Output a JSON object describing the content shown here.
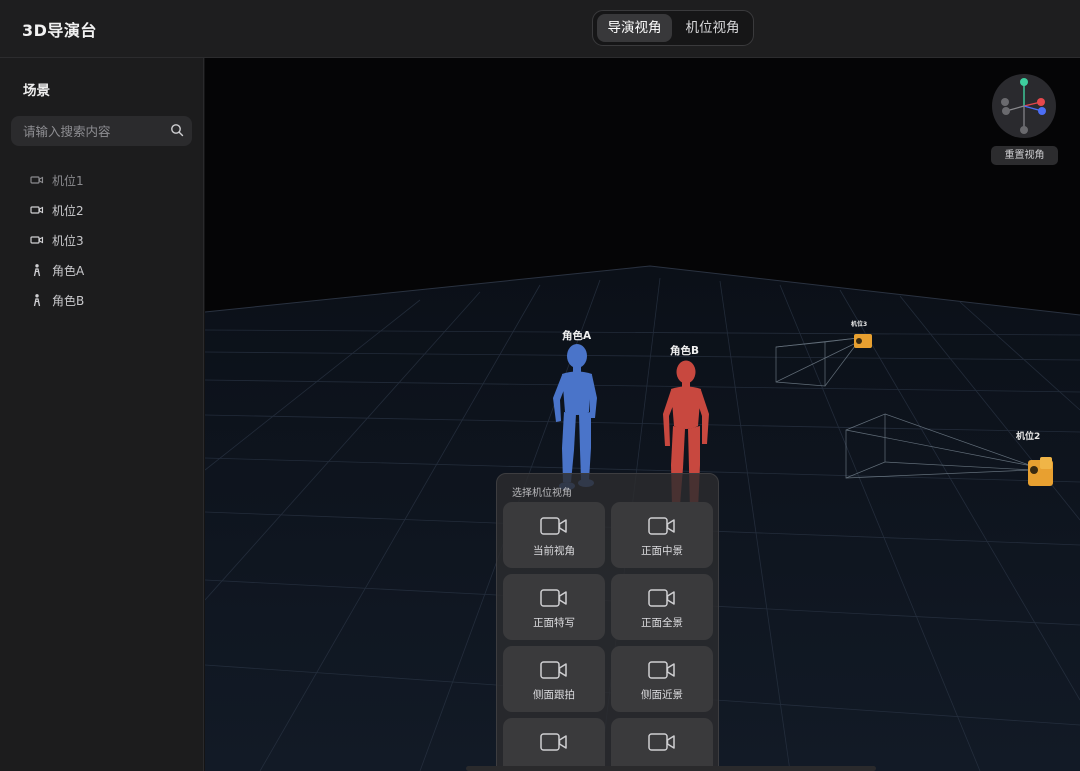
{
  "header": {
    "app_title": "3D导演台",
    "view_toggle": [
      {
        "label": "导演视角",
        "active": true
      },
      {
        "label": "机位视角",
        "active": false
      }
    ]
  },
  "sidebar": {
    "title": "场景",
    "search_placeholder": "请输入搜索内容",
    "items": [
      {
        "label": "机位1",
        "icon": "camera-icon",
        "dim": true
      },
      {
        "label": "机位2",
        "icon": "camera-icon",
        "dim": false
      },
      {
        "label": "机位3",
        "icon": "camera-icon",
        "dim": false
      },
      {
        "label": "角色A",
        "icon": "person-icon",
        "dim": false
      },
      {
        "label": "角色B",
        "icon": "person-icon",
        "dim": false
      }
    ]
  },
  "viewport": {
    "reset_view_label": "重置视角",
    "characters": [
      {
        "label": "角色A",
        "color": "#4a74c9"
      },
      {
        "label": "角色B",
        "color": "#c8483f"
      }
    ],
    "cameras": [
      {
        "label": "机位3"
      },
      {
        "label": "机位2"
      }
    ],
    "camera_color": "#e8a030",
    "axis_colors": {
      "x": "#e5484d",
      "y": "#3ecf9e",
      "z": "#4c6ef5"
    }
  },
  "camera_picker": {
    "title": "选择机位视角",
    "presets": [
      "当前视角",
      "正面中景",
      "正面特写",
      "正面全景",
      "侧面跟拍",
      "侧面近景",
      "",
      ""
    ]
  }
}
